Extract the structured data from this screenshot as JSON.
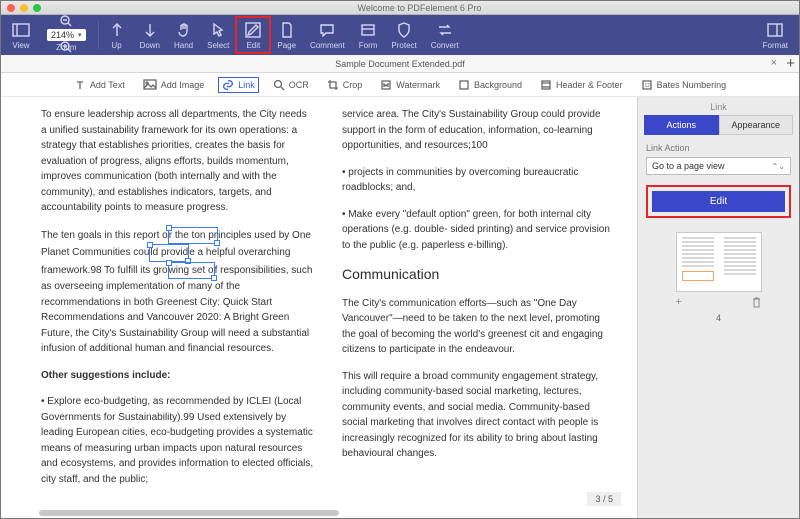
{
  "window_title": "Welcome to PDFelement 6 Pro",
  "toolbar_top": {
    "view": "View",
    "zoom": "Zoom",
    "zoom_value": "214%",
    "up": "Up",
    "down": "Down",
    "hand": "Hand",
    "select": "Select",
    "edit": "Edit",
    "page": "Page",
    "comment": "Comment",
    "form": "Form",
    "protect": "Protect",
    "convert": "Convert",
    "format": "Format"
  },
  "tab_name": "Sample Document Extended.pdf",
  "toolrow": {
    "add_text": "Add Text",
    "add_image": "Add Image",
    "link": "Link",
    "ocr": "OCR",
    "crop": "Crop",
    "watermark": "Watermark",
    "background": "Background",
    "header_footer": "Header & Footer",
    "bates": "Bates Numbering"
  },
  "doc": {
    "col1": {
      "p1": "To ensure leadership across all departments, the City needs a unified sustainability framework for its own operations: a strategy that establishes priorities, creates the basis for evaluation of progress, aligns efforts, builds momentum, improves communication (both internally and with the community), and establishes indicators, targets, and accountability points to measure progress.",
      "p2a": "The ten goals in this report o",
      "p2_sel": "r the ton pr",
      "p2b": "inciples used by One Planet Communities cou",
      "p2_sel2": "ld provid",
      "p2c": "e a helpful overarching framework.98 To fulfill its gro",
      "p2_sel3": "wing set o",
      "p2d": "f responsibilities, such as overseeing implementation of many of the recommendations in both Greenest City: Quick Start Recommendations and Vancouver 2020: A Bright Green Future, the City's Sustainability Group will need a substantial infusion of additional human and financial resources.",
      "h_other": "Other suggestions include:",
      "p3": "• Explore eco-budgeting, as recommended by ICLEI (Local Governments for Sustainability).99 Used extensively by leading European cities, eco-budgeting provides a systematic means of measuring urban impacts upon natural resources and ecosystems, and provides information to elected officials, city staff, and the public;"
    },
    "col2": {
      "p1": "service area. The City's Sustainability Group could provide support in the form of education, information, co-learning opportunities, and resources;100",
      "p2": "• projects in communities by overcoming bureaucratic roadblocks; and,",
      "p3": "• Make every \"default option\" green, for both internal city operations (e.g. double- sided printing) and service provision to the public (e.g. paperless e-billing).",
      "h": "Communication",
      "p4": "The City's communication efforts—such as \"One Day Vancouver\"—need to be taken to the next level, promoting the goal of becoming the world's greenest cit and engaging citizens to participate in the endeavour.",
      "p5": "This will require a broad community engagement strategy, including community-based social marketing, lectures, community events, and social media. Community-based social marketing that involves direct contact with people is increasingly recognized for its ability to bring about lasting behavioural changes."
    },
    "page_indicator": "3 / 5"
  },
  "side": {
    "title": "Link",
    "tab_actions": "Actions",
    "tab_appearance": "Appearance",
    "link_action_label": "Link Action",
    "dropdown_value": "Go to a page view",
    "edit_button": "Edit",
    "thumb_number": "4"
  }
}
